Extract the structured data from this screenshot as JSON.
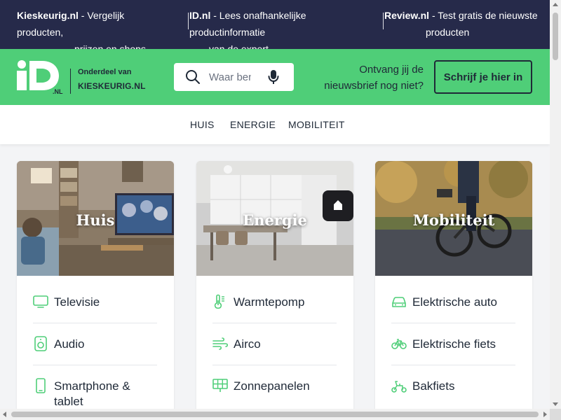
{
  "topbar": {
    "items": [
      {
        "brand": "Kieskeurig.nl",
        "text_line1": " - Vergelijk producten,",
        "text_line2": "prijzen en shops"
      },
      {
        "brand": "ID.nl",
        "text_line1": " - Lees onafhankelijke productinformatie",
        "text_line2": "van de expert"
      },
      {
        "brand": "Review.nl",
        "text_line1": " - Test gratis de nieuwste",
        "text_line2": "producten"
      }
    ]
  },
  "header": {
    "logo_suffix": ".NL",
    "onderdeel_label": "Onderdeel van",
    "partner_logo_text": "KIESKEURIG.NL",
    "search_placeholder": "Waar ben je naar op zoek?",
    "newsletter_line1": "Ontvang jij de",
    "newsletter_line2": "nieuwsbrief nog niet?",
    "subscribe_label": "Schrijf je hier in"
  },
  "nav": {
    "items": [
      {
        "label": "HUIS"
      },
      {
        "label": "ENERGIE"
      },
      {
        "label": "MOBILITEIT"
      }
    ]
  },
  "cards": [
    {
      "title": "Huis",
      "items": [
        {
          "label": "Televisie",
          "icon": "tv-icon"
        },
        {
          "label": "Audio",
          "icon": "speaker-icon"
        },
        {
          "label": "Smartphone & tablet",
          "icon": "smartphone-icon"
        }
      ]
    },
    {
      "title": "Energie",
      "items": [
        {
          "label": "Warmtepomp",
          "icon": "thermometer-icon"
        },
        {
          "label": "Airco",
          "icon": "wind-icon"
        },
        {
          "label": "Zonnepanelen",
          "icon": "solar-panel-icon"
        }
      ]
    },
    {
      "title": "Mobiliteit",
      "items": [
        {
          "label": "Elektrische auto",
          "icon": "car-icon"
        },
        {
          "label": "Elektrische fiets",
          "icon": "bicycle-icon"
        },
        {
          "label": "Bakfiets",
          "icon": "cargo-bike-icon"
        }
      ]
    }
  ],
  "colors": {
    "topbar_bg": "#262a4a",
    "header_green": "#4fce78",
    "icon_green": "#4fce78",
    "text_dark": "#1f2937"
  }
}
